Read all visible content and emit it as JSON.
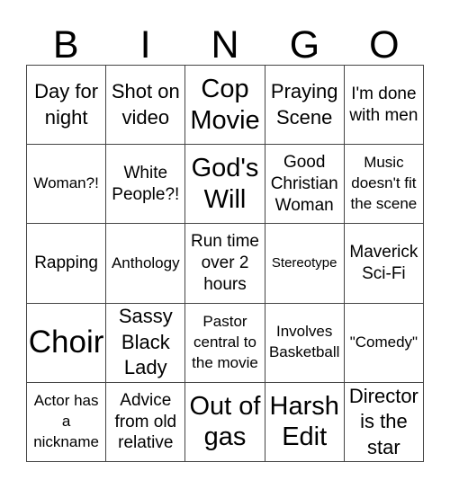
{
  "header": {
    "letters": [
      "B",
      "I",
      "N",
      "G",
      "O"
    ]
  },
  "card": {
    "rows": [
      [
        {
          "text": "Day for night",
          "size": "l"
        },
        {
          "text": "Shot on video",
          "size": "l"
        },
        {
          "text": "Cop Movie",
          "size": "xl"
        },
        {
          "text": "Praying Scene",
          "size": "l"
        },
        {
          "text": "I'm done with men",
          "size": "m"
        }
      ],
      [
        {
          "text": "Woman?!",
          "size": "s"
        },
        {
          "text": "White People?!",
          "size": "m"
        },
        {
          "text": "God's Will",
          "size": "xl"
        },
        {
          "text": "Good Christian Woman",
          "size": "m"
        },
        {
          "text": "Music doesn't fit the scene",
          "size": "s"
        }
      ],
      [
        {
          "text": "Rapping",
          "size": "m"
        },
        {
          "text": "Anthology",
          "size": "s"
        },
        {
          "text": "Run time over 2 hours",
          "size": "m"
        },
        {
          "text": "Stereotype",
          "size": "xs"
        },
        {
          "text": "Maverick Sci-Fi",
          "size": "m"
        }
      ],
      [
        {
          "text": "Choir",
          "size": "xxl"
        },
        {
          "text": "Sassy Black Lady",
          "size": "l"
        },
        {
          "text": "Pastor central to the movie",
          "size": "s"
        },
        {
          "text": "Involves Basketball",
          "size": "s"
        },
        {
          "text": "\"Comedy\"",
          "size": "s"
        }
      ],
      [
        {
          "text": "Actor has a nickname",
          "size": "s"
        },
        {
          "text": "Advice from old relative",
          "size": "m"
        },
        {
          "text": "Out of gas",
          "size": "xl"
        },
        {
          "text": "Harsh Edit",
          "size": "xl"
        },
        {
          "text": "Director is the star",
          "size": "l"
        }
      ]
    ]
  }
}
